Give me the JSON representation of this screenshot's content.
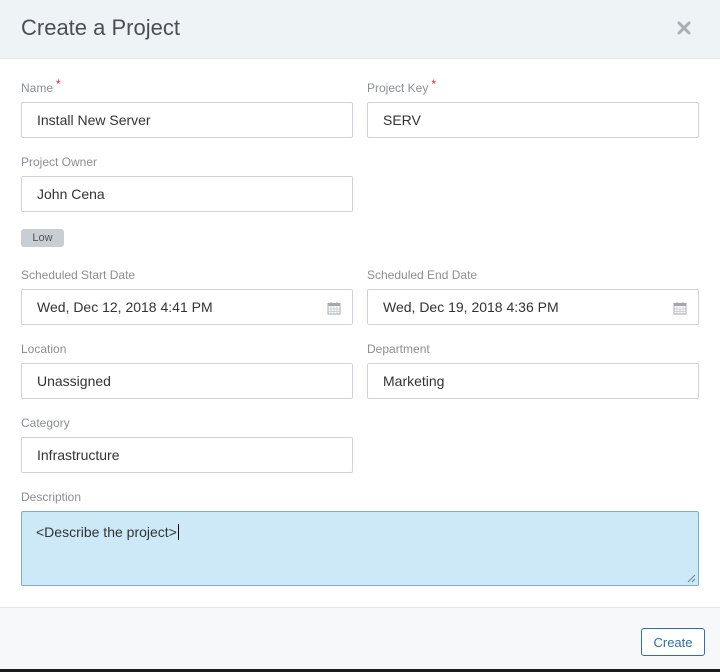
{
  "dialog": {
    "title": "Create a Project"
  },
  "fields": {
    "name": {
      "label": "Name",
      "required_marker": "*",
      "value": "Install New Server"
    },
    "project_key": {
      "label": "Project Key",
      "required_marker": "*",
      "value": "SERV"
    },
    "project_owner": {
      "label": "Project Owner",
      "value": "John Cena"
    },
    "priority_badge": "Low",
    "start_date": {
      "label": "Scheduled Start Date",
      "value": "Wed, Dec 12, 2018 4:41 PM"
    },
    "end_date": {
      "label": "Scheduled End Date",
      "value": "Wed, Dec 19, 2018 4:36 PM"
    },
    "location": {
      "label": "Location",
      "value": "Unassigned"
    },
    "department": {
      "label": "Department",
      "value": "Marketing"
    },
    "category": {
      "label": "Category",
      "value": "Infrastructure"
    },
    "description": {
      "label": "Description",
      "value": "<Describe the project>"
    }
  },
  "footer": {
    "create_label": "Create"
  },
  "icons": {
    "close": "close-x-icon",
    "calendar": "calendar-icon"
  },
  "colors": {
    "header_bg": "#eef3f6",
    "required": "#e0262d",
    "accent": "#2f6fa6",
    "description_bg": "#cde9f8"
  }
}
